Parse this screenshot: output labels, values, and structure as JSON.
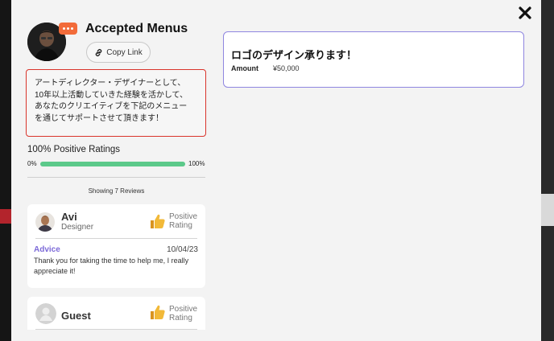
{
  "modal": {
    "title": "Accepted Menus",
    "copy_link_label": "Copy Link",
    "bio_lines": [
      "アートディレクター・デザイナーとして、",
      "10年以上活動していきた経験を活かして、",
      "あなたのクリエイティブを下記のメニュー",
      "を通じてサポートさせて頂きます！"
    ],
    "ratings_title": "100% Positive Ratings",
    "bar_min_label": "0%",
    "bar_max_label": "100%",
    "bar_fill_fraction": 1.0,
    "showing_text": "Showing 7 Reviews"
  },
  "reviews": [
    {
      "name": "Avi",
      "role": "Designer",
      "rating_label_1": "Positive",
      "rating_label_2": "Rating",
      "type": "Advice",
      "date": "10/04/23",
      "text": "Thank you for taking the time to help me, I really appreciate it!"
    },
    {
      "name": "Guest",
      "rating_label_1": "Positive",
      "rating_label_2": "Rating"
    }
  ],
  "menu": {
    "title": "ロゴのデザイン承ります！",
    "amount_label": "Amount",
    "amount_value": "¥50,000"
  },
  "colors": {
    "accent": "#7c6ad8",
    "progress": "#5cc98a",
    "bio_border": "#d9342b",
    "badge": "#f26b3a"
  }
}
